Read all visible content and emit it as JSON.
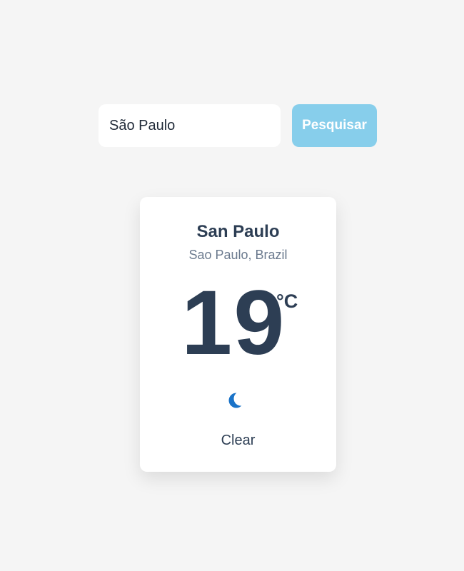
{
  "search": {
    "value": "São Paulo",
    "button_label": "Pesquisar"
  },
  "weather": {
    "city": "San Paulo",
    "location": "Sao Paulo, Brazil",
    "temperature": "19",
    "unit": "°C",
    "icon": "moon-icon",
    "condition": "Clear"
  },
  "colors": {
    "background": "#f5f5f5",
    "button": "#87ceeb",
    "text_primary": "#2d3e54",
    "text_secondary": "#6b7a8e",
    "icon": "#1a73c8"
  }
}
